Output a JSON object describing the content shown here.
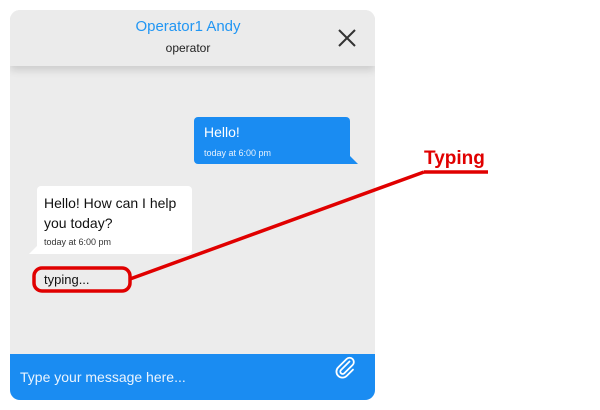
{
  "header": {
    "title": "Operator1 Andy",
    "subtitle": "operator"
  },
  "messages": [
    {
      "direction": "outgoing",
      "text": "Hello!",
      "time": "today at 6:00 pm"
    },
    {
      "direction": "incoming",
      "text": "Hello! How can I help you today?",
      "time": "today at 6:00 pm"
    }
  ],
  "typing_indicator": "typing...",
  "composer": {
    "placeholder": "Type your message here..."
  },
  "annotation": {
    "label": "Typing",
    "color": "#e00000"
  },
  "colors": {
    "accent": "#1a8cf2",
    "title": "#2196f3",
    "background": "#ececec"
  },
  "icons": [
    "close-icon",
    "paperclip-icon"
  ]
}
